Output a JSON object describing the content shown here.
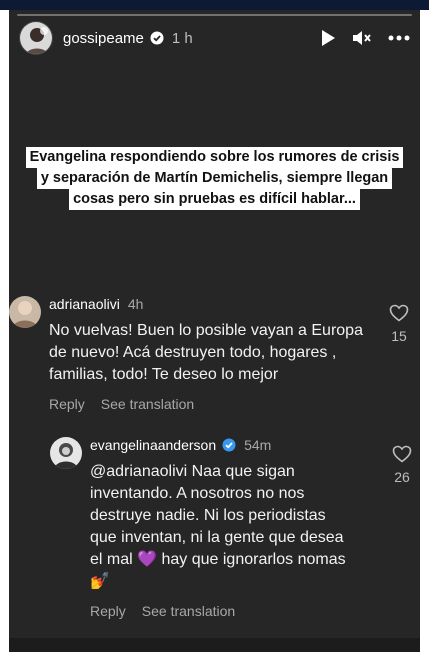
{
  "story": {
    "username": "gossipeame",
    "time": "1 h",
    "progress_fraction": 0.0,
    "caption_lines": [
      "Evangelina respondiendo sobre los rumores de crisis",
      "y separación de Martín Demichelis, siempre llegan",
      "cosas pero sin pruebas es difícil hablar..."
    ]
  },
  "comments": [
    {
      "username": "adrianaolivi",
      "time": "4h",
      "text_lines": [
        "No vuelvas! Buen lo posible vayan a Europa",
        "de nuevo! Acá destruyen todo, hogares ,",
        "familias, todo! Te deseo lo mejor"
      ],
      "likes": "15",
      "reply_label": "Reply",
      "translation_label": "See translation"
    },
    {
      "username": "evangelinaanderson",
      "verified": true,
      "time": "54m",
      "text_lines": [
        "@adrianaolivi Naa que sigan",
        "inventando. A nosotros no nos",
        "destruye nadie. Ni los periodistas",
        "que inventan, ni la gente que desea",
        "el mal 💜 hay que ignorarlos nomas",
        "💅"
      ],
      "likes": "26",
      "reply_label": "Reply",
      "translation_label": "See translation"
    }
  ],
  "icons": {
    "verified": "verified-badge-icon",
    "play": "play-icon",
    "mute": "muted-speaker-icon",
    "more": "more-options-icon",
    "heart": "heart-outline-icon"
  },
  "colors": {
    "background": "#262626",
    "verified_blue": "#3897f0",
    "caption_bg": "#ffffff"
  }
}
